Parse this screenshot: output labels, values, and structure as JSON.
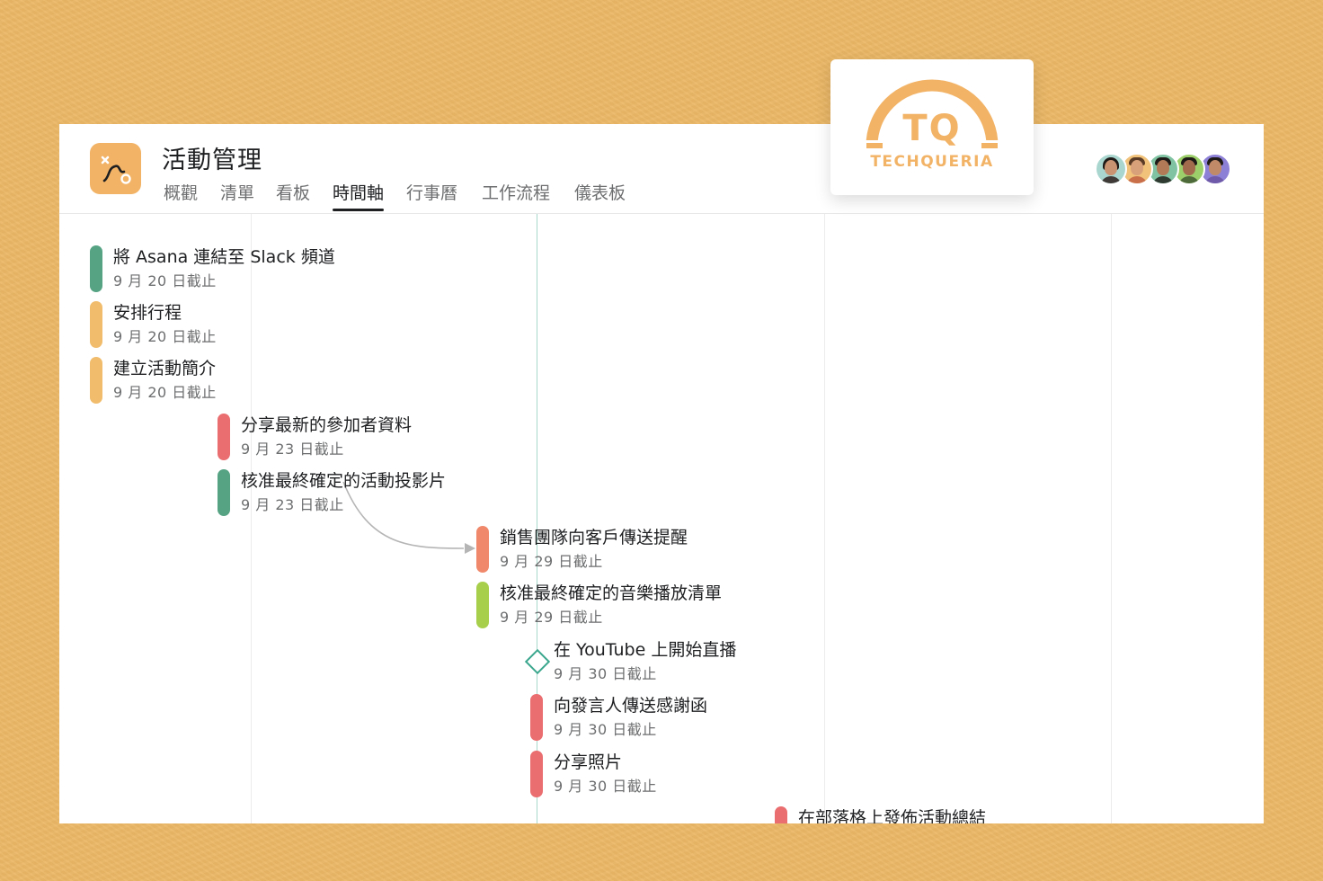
{
  "project": {
    "title": "活動管理",
    "icon": "route-icon"
  },
  "tabs": [
    {
      "label": "概觀",
      "active": false
    },
    {
      "label": "清單",
      "active": false
    },
    {
      "label": "看板",
      "active": false
    },
    {
      "label": "時間軸",
      "active": true
    },
    {
      "label": "行事曆",
      "active": false
    },
    {
      "label": "工作流程",
      "active": false
    },
    {
      "label": "儀表板",
      "active": false
    }
  ],
  "logo": {
    "mark": "TQ",
    "name": "TECHQUERIA",
    "color": "#f2b366"
  },
  "members": [
    {
      "name": "member-1",
      "skin": "#c99372",
      "shirt": "#3f3a37"
    },
    {
      "name": "member-2",
      "skin": "#d9a17a",
      "shirt": "#c96f4a"
    },
    {
      "name": "member-3",
      "skin": "#b27a57",
      "shirt": "#2f3b31"
    },
    {
      "name": "member-4",
      "skin": "#a36b4e",
      "shirt": "#4e6a3a"
    },
    {
      "name": "member-5",
      "skin": "#c08a69",
      "shirt": "#6e5aa8"
    }
  ],
  "colors": {
    "green": "#55a383",
    "yellow": "#f1bd6c",
    "red": "#ea6d6f",
    "coral": "#f0896b",
    "lime": "#a8cf4c",
    "milestone": "#3aa68d"
  },
  "tasks": [
    {
      "name": "將 Asana 連結至 Slack 頻道",
      "due": "9 月 20 日截止",
      "color": "green"
    },
    {
      "name": "安排行程",
      "due": "9 月 20 日截止",
      "color": "yellow"
    },
    {
      "name": "建立活動簡介",
      "due": "9 月 20 日截止",
      "color": "yellow"
    },
    {
      "name": "分享最新的參加者資料",
      "due": "9 月 23 日截止",
      "color": "red"
    },
    {
      "name": "核准最終確定的活動投影片",
      "due": "9 月 23 日截止",
      "color": "green"
    },
    {
      "name": "銷售團隊向客戶傳送提醒",
      "due": "9 月 29 日截止",
      "color": "coral"
    },
    {
      "name": "核准最終確定的音樂播放清單",
      "due": "9 月 29 日截止",
      "color": "lime"
    },
    {
      "name": "在 YouTube 上開始直播",
      "due": "9 月 30 日截止",
      "color": "milestone",
      "milestone": true
    },
    {
      "name": "向發言人傳送感謝函",
      "due": "9 月 30 日截止",
      "color": "red"
    },
    {
      "name": "分享照片",
      "due": "9 月 30 日截止",
      "color": "red"
    },
    {
      "name": "在部落格上發佈活動總結",
      "due": "",
      "color": "red"
    }
  ]
}
